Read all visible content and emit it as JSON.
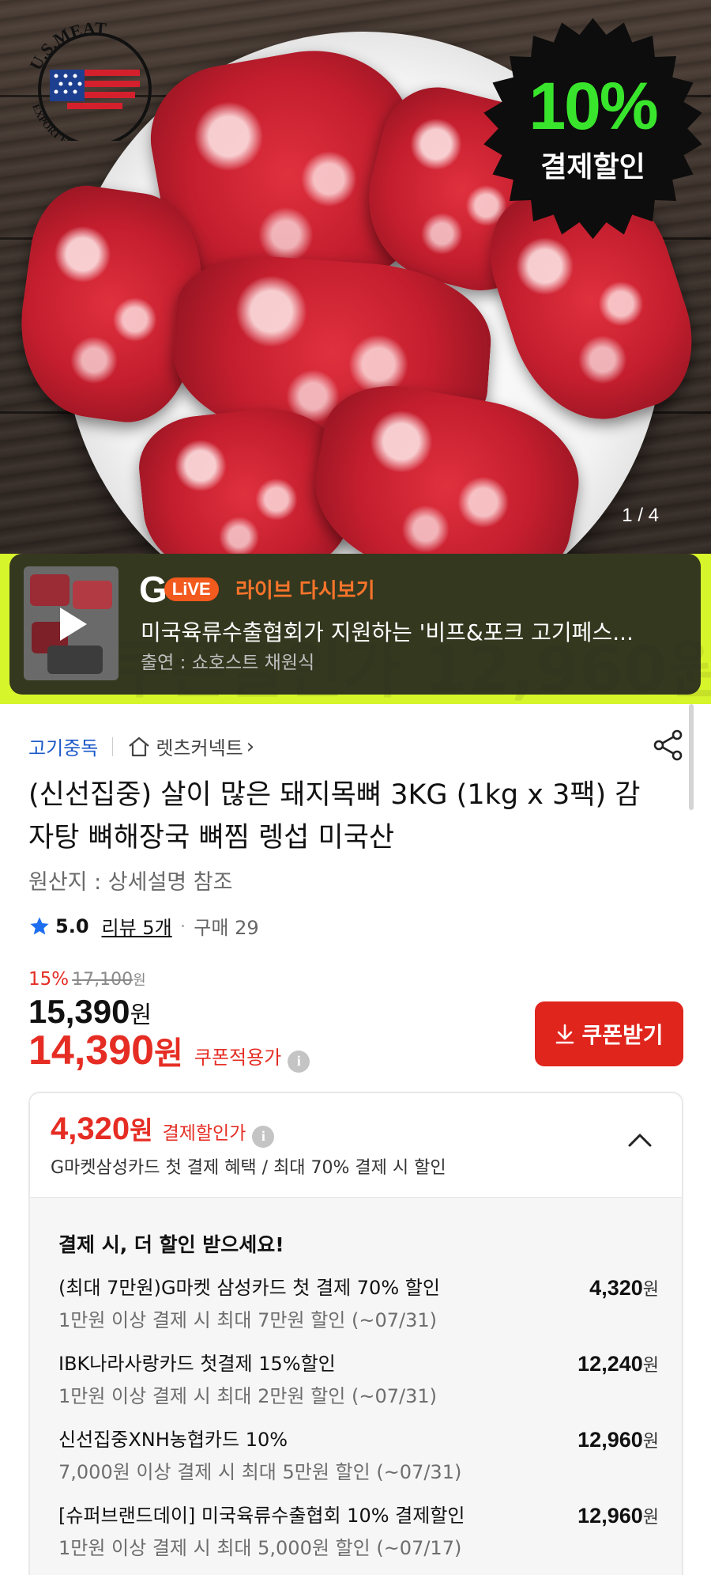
{
  "hero": {
    "logo_text_top": "U.S.MEAT",
    "logo_text_bottom": "EXPORT FEDERATION",
    "badge_percent": "10%",
    "badge_label": "결제할인",
    "page_counter": "1 / 4"
  },
  "live_banner": {
    "logo_letter": "G",
    "logo_pill": "LiVE",
    "title": "라이브 다시보기",
    "description": "미국육류수출협회가 지원하는 '비프&포크 고기페스...",
    "cast": "출연 : 쇼호스트 채원식",
    "background_price": "쿠폰할인가 12,960원"
  },
  "breadcrumb": {
    "category": "고기중독",
    "store": "렛츠커넥트",
    "store_chevron": "›"
  },
  "product": {
    "title": "(신선집중) 살이 많은 돼지목뼈 3KG (1kg x 3팩) 감자탕 뼈해장국 뼈찜 렝섭 미국산",
    "origin": "원산지 : 상세설명 참조",
    "rating": "5.0",
    "reviews": "리뷰 5개",
    "dot": "·",
    "purchases": "구매 29"
  },
  "pricing": {
    "discount_percent": "15%",
    "original_price": "17,100",
    "original_unit": "원",
    "sale_price": "15,390",
    "sale_unit": "원",
    "coupon_price": "14,390",
    "coupon_unit": "원",
    "coupon_label": "쿠폰적용가",
    "info_glyph": "i",
    "coupon_button": "쿠폰받기"
  },
  "payment": {
    "amount": "4,320",
    "unit": "원",
    "label": "결제할인가",
    "info_glyph": "i",
    "subtitle": "G마켓삼성카드 첫 결제 혜택 / 최대 70% 결제 시 할인",
    "body_title": "결제 시, 더 할인 받으세요!",
    "offers": [
      {
        "name": "(최대 7만원)G마켓 삼성카드 첫 결제 70% 할인",
        "condition": "1만원 이상 결제 시 최대 7만원 할인 (~07/31)",
        "amount": "4,320",
        "unit": "원"
      },
      {
        "name": "IBK나라사랑카드 첫결제 15%할인",
        "condition": "1만원 이상 결제 시 최대 2만원 할인 (~07/31)",
        "amount": "12,240",
        "unit": "원"
      },
      {
        "name": "신선집중XNH농협카드 10%",
        "condition": "7,000원 이상 결제 시 최대 5만원 할인 (~07/31)",
        "amount": "12,960",
        "unit": "원"
      },
      {
        "name": "[슈퍼브랜드데이] 미국육류수출협회 10% 결제할인",
        "condition": "1만원 이상 결제 시 최대 5,000원 할인 (~07/17)",
        "amount": "12,960",
        "unit": "원"
      }
    ]
  },
  "colors": {
    "accent_red": "#e52d24",
    "link_blue": "#1b59c9",
    "live_orange": "#f8742a",
    "badge_green": "#39e52c",
    "lime_band": "#d7f52b"
  },
  "icons": [
    "house-icon",
    "share-icon",
    "star-icon",
    "info-icon",
    "download-icon",
    "chevron-up-icon",
    "play-icon"
  ]
}
